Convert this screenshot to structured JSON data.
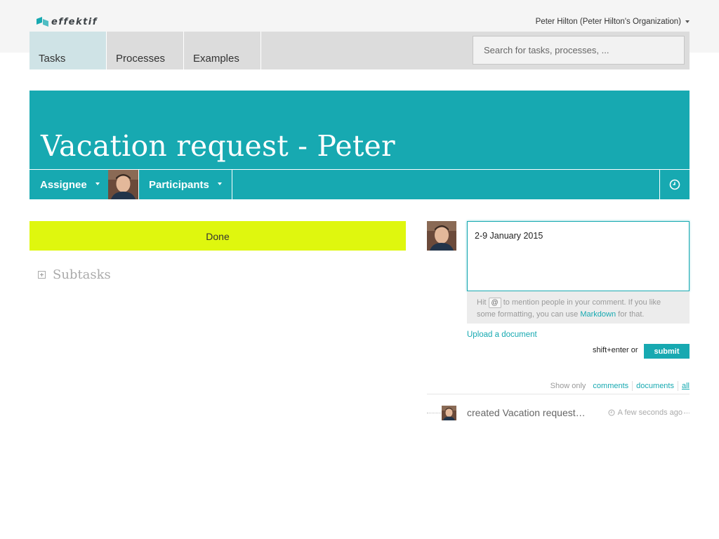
{
  "app": {
    "logo_text": "effektif",
    "user_menu": "Peter Hilton (Peter Hilton's Organization)"
  },
  "nav": {
    "tabs": [
      {
        "label": "Tasks",
        "active": true
      },
      {
        "label": "Processes",
        "active": false
      },
      {
        "label": "Examples",
        "active": false
      }
    ],
    "search_placeholder": "Search for tasks, processes, ..."
  },
  "task": {
    "title": "Vacation request - Peter",
    "assignee_label": "Assignee",
    "participants_label": "Participants",
    "done_label": "Done",
    "subtasks_label": "Subtasks"
  },
  "comment": {
    "value": "2-9 January 2015",
    "hint_pre": "Hit",
    "hint_key": "@",
    "hint_mid": "to mention people in your comment. If you like some formatting, you can use",
    "hint_link": "Markdown",
    "hint_post": "for that.",
    "upload_label": "Upload a document",
    "shortcut_label": "shift+enter or",
    "submit_label": "submit"
  },
  "filter": {
    "show_only_label": "Show only",
    "options": [
      "comments",
      "documents",
      "all"
    ],
    "active": "all"
  },
  "activity": [
    {
      "text": "created Vacation request…",
      "time": "A few seconds ago"
    }
  ],
  "colors": {
    "accent": "#17a9b1",
    "done_button": "#dff70e",
    "nav_bg": "#dcdcdc",
    "active_tab_bg": "#cfe3e6"
  }
}
